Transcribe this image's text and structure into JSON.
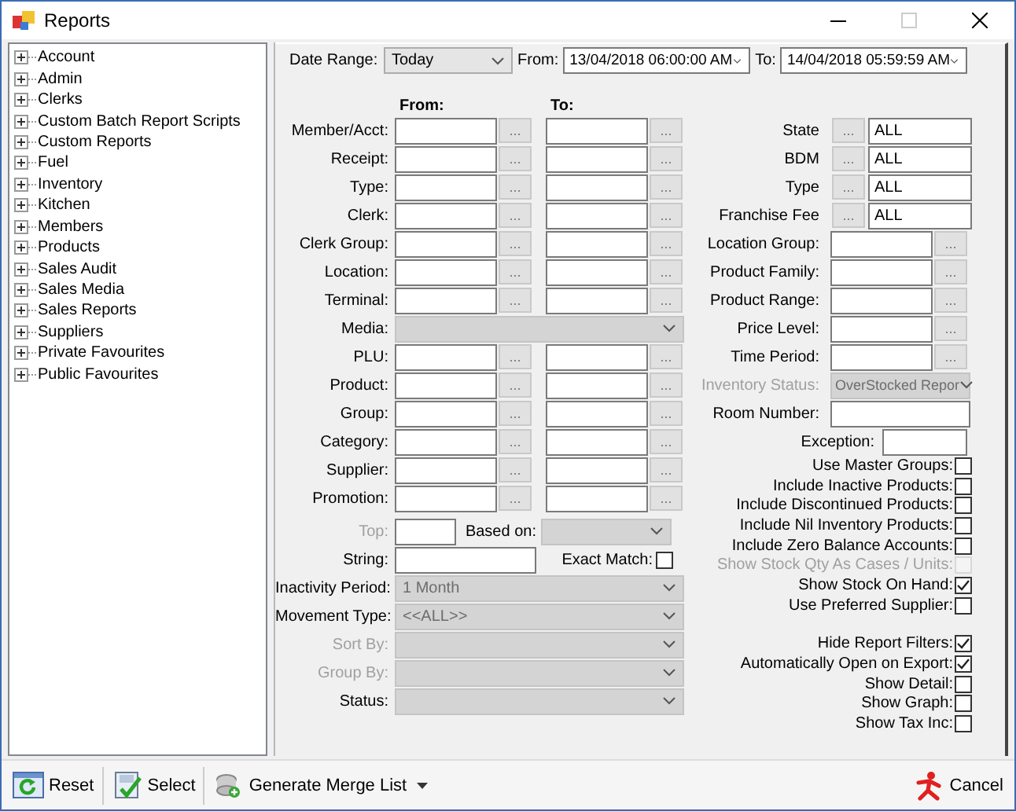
{
  "window": {
    "title": "Reports"
  },
  "tree": [
    {
      "label": "Account",
      "expanded": false
    },
    {
      "label": "Admin",
      "expanded": false
    },
    {
      "label": "Clerks",
      "expanded": false
    },
    {
      "label": "Custom Batch Report Scripts",
      "expanded": false
    },
    {
      "label": "Custom Reports",
      "expanded": false
    },
    {
      "label": "Fuel",
      "expanded": false
    },
    {
      "label": "Inventory",
      "expanded": false
    },
    {
      "label": "Kitchen",
      "expanded": false
    },
    {
      "label": "Members",
      "expanded": false
    },
    {
      "label": "Products",
      "expanded": false
    },
    {
      "label": "Sales Audit",
      "expanded": false
    },
    {
      "label": "Sales Media",
      "expanded": false
    },
    {
      "label": "Sales Reports",
      "expanded": false
    },
    {
      "label": "Suppliers",
      "expanded": false
    },
    {
      "label": "Private Favourites",
      "expanded": false
    },
    {
      "label": "Public Favourites",
      "expanded": false
    }
  ],
  "date_range": {
    "label": "Date Range:",
    "value": "Today",
    "from_label": "From:",
    "from": "13/04/2018 06:00:00 AM",
    "to_label": "To:",
    "to": "14/04/2018 05:59:59 AM"
  },
  "filters": {
    "from_header": "From:",
    "to_header": "To:",
    "rows": [
      {
        "kind": "range",
        "label": "Member/Acct:",
        "label_disabled": false,
        "from_button": "...",
        "to_button": "..."
      },
      {
        "kind": "range",
        "label": "Receipt:",
        "label_disabled": false,
        "from_button": "...",
        "to_button": "..."
      },
      {
        "kind": "range",
        "label": "Type:",
        "label_disabled": false,
        "from_button": "...",
        "to_button": "..."
      },
      {
        "kind": "range",
        "label": "Clerk:",
        "label_disabled": false,
        "from_button": "...",
        "to_button": "..."
      },
      {
        "kind": "range",
        "label": "Clerk Group:",
        "label_disabled": false,
        "from_button": "...",
        "to_button": "..."
      },
      {
        "kind": "range",
        "label": "Location:",
        "label_disabled": false,
        "from_button": "...",
        "to_button": "..."
      },
      {
        "kind": "range",
        "label": "Terminal:",
        "label_disabled": false,
        "from_button": "...",
        "to_button": "..."
      },
      {
        "kind": "combo",
        "label": "Media:",
        "label_disabled": false,
        "disabled": true
      },
      {
        "kind": "range",
        "label": "PLU:",
        "label_disabled": false,
        "from_button": "...",
        "to_button": "..."
      },
      {
        "kind": "range",
        "label": "Product:",
        "label_disabled": false,
        "from_button": "...",
        "to_button": "..."
      },
      {
        "kind": "range",
        "label": "Group:",
        "label_disabled": false,
        "from_button": "...",
        "to_button": "..."
      },
      {
        "kind": "range",
        "label": "Category:",
        "label_disabled": false,
        "from_button": "...",
        "to_button": "..."
      },
      {
        "kind": "range",
        "label": "Supplier:",
        "label_disabled": false,
        "from_button": "...",
        "to_button": "..."
      },
      {
        "kind": "range",
        "label": "Promotion:",
        "label_disabled": false,
        "from_button": "...",
        "to_button": "..."
      },
      {
        "kind": "top",
        "label": "Top:",
        "label_disabled": true,
        "based_on_label": "Based on:",
        "based_on_disabled": true
      },
      {
        "kind": "string",
        "label": "String:",
        "label_disabled": false,
        "exact_label": "Exact Match:",
        "checked": false
      },
      {
        "kind": "combo",
        "label": "Inactivity Period:",
        "label_disabled": false,
        "value": "1 Month",
        "disabled": true
      },
      {
        "kind": "combo",
        "label": "Movement Type:",
        "label_disabled": false,
        "value": "<<ALL>>",
        "disabled": true
      },
      {
        "kind": "combo",
        "label": "Sort By:",
        "label_disabled": true,
        "disabled": true
      },
      {
        "kind": "combo",
        "label": "Group By:",
        "label_disabled": true,
        "disabled": true
      },
      {
        "kind": "combo",
        "label": "Status:",
        "label_disabled": false,
        "disabled": true
      }
    ]
  },
  "right_filters": [
    {
      "kind": "picker",
      "label": "State",
      "button": "...",
      "value": "ALL",
      "disabled": false
    },
    {
      "kind": "picker",
      "label": "BDM",
      "button": "...",
      "value": "ALL",
      "disabled": false
    },
    {
      "kind": "picker",
      "label": "Type",
      "button": "...",
      "value": "ALL",
      "disabled": false
    },
    {
      "kind": "picker",
      "label": "Franchise Fee",
      "button": "...",
      "value": "ALL",
      "disabled": false
    },
    {
      "kind": "lookup",
      "label": "Location Group:",
      "button": "...",
      "disabled": false
    },
    {
      "kind": "lookup",
      "label": "Product Family:",
      "button": "...",
      "disabled": false
    },
    {
      "kind": "lookup",
      "label": "Product Range:",
      "button": "...",
      "disabled": false
    },
    {
      "kind": "lookup",
      "label": "Price Level:",
      "button": "...",
      "disabled": false
    },
    {
      "kind": "lookup",
      "label": "Time Period:",
      "button": "...",
      "disabled": false
    },
    {
      "kind": "combo",
      "label": "Inventory Status:",
      "value": "OverStocked Repor",
      "disabled": true
    },
    {
      "kind": "text",
      "label": "Room Number:",
      "disabled": false
    },
    {
      "kind": "short",
      "label": "Exception:",
      "disabled": false
    }
  ],
  "options": [
    {
      "label": "Use Master Groups:",
      "checked": false,
      "disabled": false
    },
    {
      "label": "Include Inactive Products:",
      "checked": false,
      "disabled": false
    },
    {
      "label": "Include Discontinued Products:",
      "checked": false,
      "disabled": false
    },
    {
      "label": "Include Nil Inventory Products:",
      "checked": false,
      "disabled": false
    },
    {
      "label": "Include Zero Balance Accounts:",
      "checked": false,
      "disabled": false
    },
    {
      "label": "Show Stock Qty As Cases / Units:",
      "checked": false,
      "disabled": true
    },
    {
      "label": "Show Stock On Hand:",
      "checked": true,
      "disabled": false
    },
    {
      "label": "Use Preferred Supplier:",
      "checked": false,
      "disabled": false
    }
  ],
  "output_options": [
    {
      "label": "Hide Report Filters:",
      "checked": true,
      "disabled": false
    },
    {
      "label": "Automatically Open on Export:",
      "checked": true,
      "disabled": false
    },
    {
      "label": "Show Detail:",
      "checked": false,
      "disabled": false
    },
    {
      "label": "Show Graph:",
      "checked": false,
      "disabled": false
    },
    {
      "label": "Show Tax Inc:",
      "checked": false,
      "disabled": false
    }
  ],
  "toolbar": [
    {
      "kind": "reset",
      "label": "Reset",
      "dropdown": false
    },
    {
      "kind": "select",
      "label": "Select",
      "dropdown": false
    },
    {
      "kind": "merge",
      "label": "Generate Merge List",
      "dropdown": true
    }
  ],
  "cancel": {
    "label": "Cancel"
  }
}
